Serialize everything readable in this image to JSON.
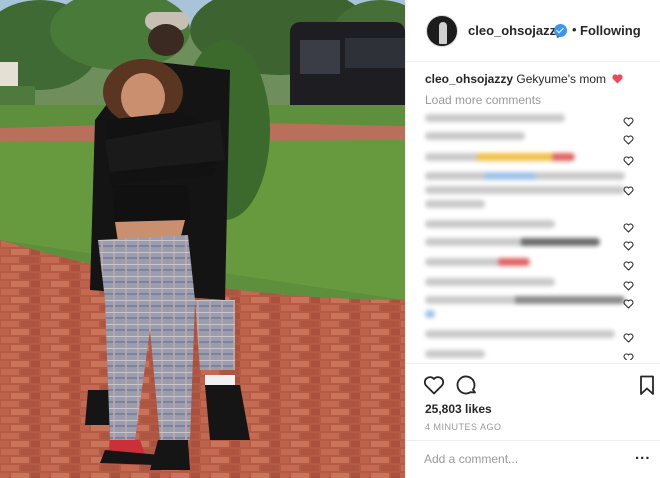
{
  "post": {
    "username": "cleo_ohsojazzy",
    "follow_status": "Following",
    "separator": "•",
    "caption_text": "Gekyume's mom",
    "load_more": "Load more comments",
    "likes": "25,803 likes",
    "timestamp": "4 MINUTES AGO",
    "add_comment_placeholder": "Add a comment...",
    "more_options": "...",
    "icons": {
      "verified": "verified-badge-icon",
      "caption_emoji": "red-heart-emoji",
      "like": "heart-outline-icon",
      "comment": "speech-bubble-icon",
      "save": "bookmark-icon",
      "comment_like": "small-heart-icon"
    }
  },
  "colors": {
    "accent_blue": "#3897f0",
    "text": "#262626",
    "muted": "#999999",
    "heart_red": "#ed4956"
  }
}
